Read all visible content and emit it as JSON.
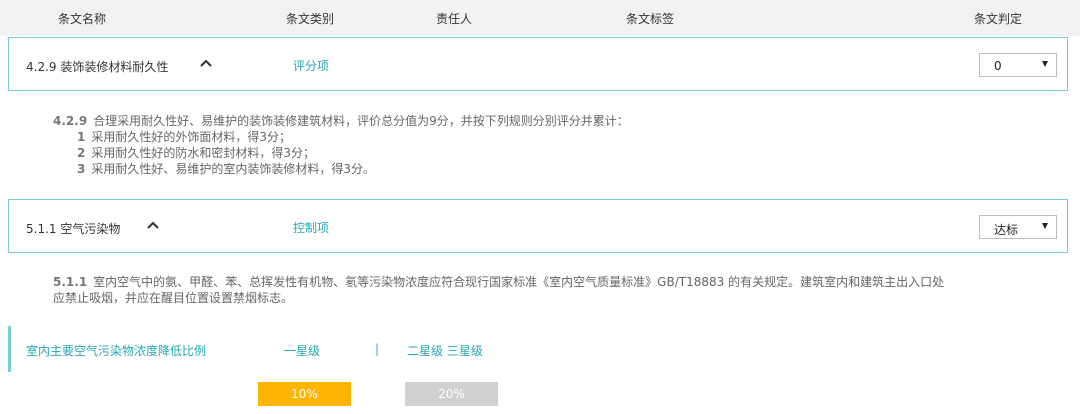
{
  "header": {
    "name": "条文名称",
    "type": "条文类别",
    "owner": "责任人",
    "tags": "条文标签",
    "judge": "条文判定"
  },
  "clauses": [
    {
      "title": "4.2.9  装饰装修材料耐久性",
      "type": "评分项",
      "judge_value": "0",
      "desc_num": "4.2.9",
      "desc_text": "合理采用耐久性好、易维护的装饰装修建筑材料，评价总分值为9分，并按下列规则分别评分并累计：",
      "rules": [
        {
          "num": "1",
          "text": "采用耐久性好的外饰面材料，得3分；"
        },
        {
          "num": "2",
          "text": "采用耐久性好的防水和密封材料，得3分；"
        },
        {
          "num": "3",
          "text": "采用耐久性好、易维护的室内装饰装修材料，得3分。"
        }
      ]
    },
    {
      "title": "5.1.1  空气污染物",
      "type": "控制项",
      "judge_value": "达标",
      "desc_num": "5.1.1",
      "desc_line1": "室内空气中的氨、甲醛、苯、总挥发性有机物、氡等污染物浓度应符合现行国家标准《室内空气质量标准》GB/T18883 的有关规定。建筑室内和建筑主出入口处",
      "desc_line2": "应禁止吸烟，并应在醒目位置设置禁烟标志。"
    }
  ],
  "indicator": {
    "label": "室内主要空气污染物浓度降低比例",
    "one_star": "一星级",
    "divider": "|",
    "two_three_star": "二星级 三星级"
  },
  "bars": [
    {
      "label": "10%",
      "color": "#ffb400"
    },
    {
      "label": "20%",
      "color": "#d0d0d0"
    }
  ]
}
